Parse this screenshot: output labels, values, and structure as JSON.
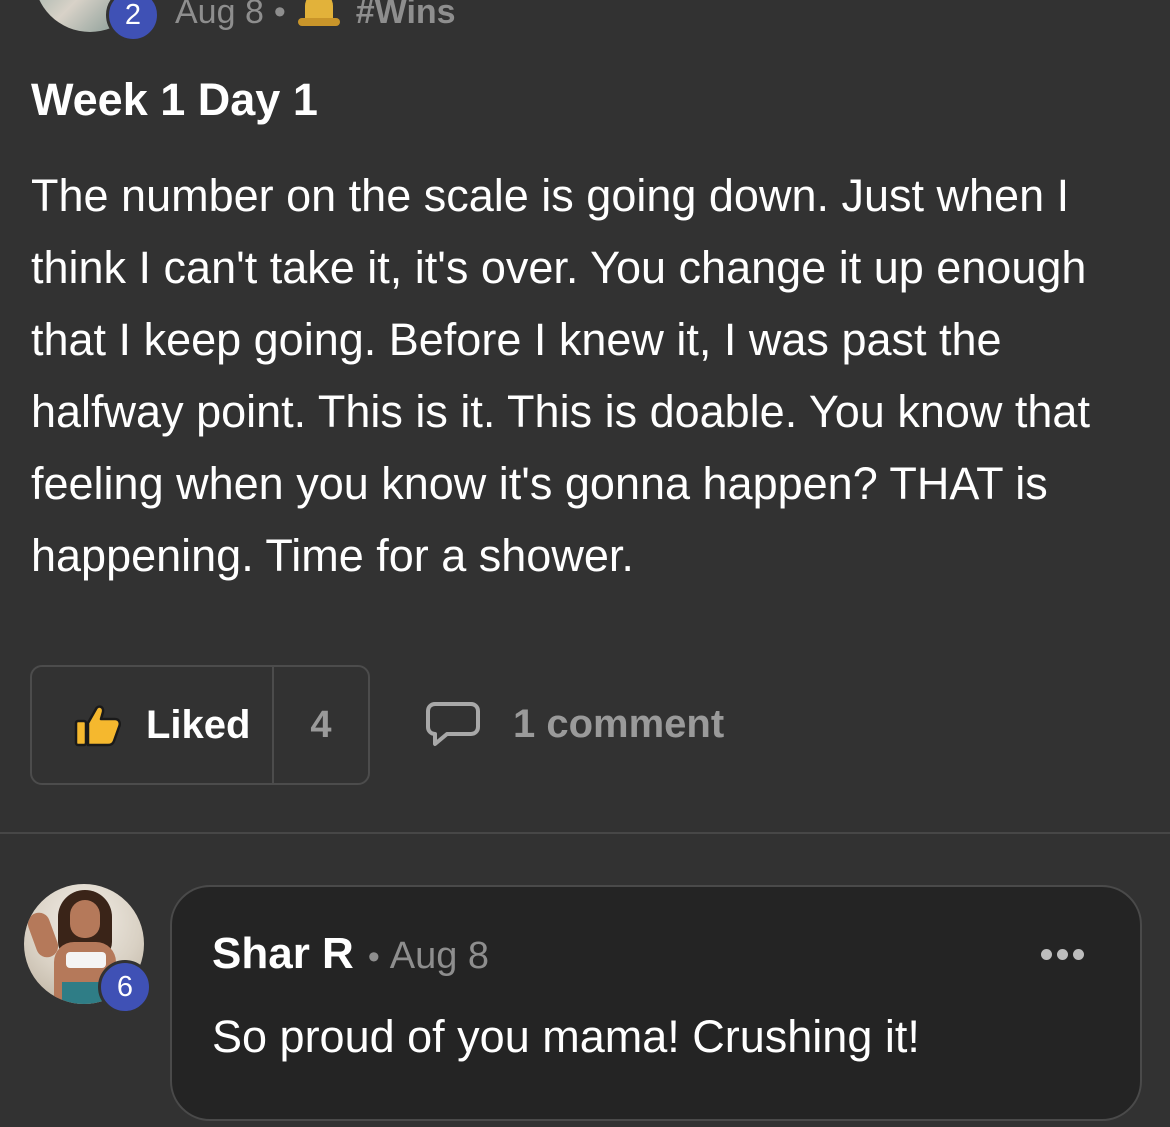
{
  "post": {
    "author_level": "2",
    "date": "Aug 8",
    "separator": "•",
    "category": "#Wins",
    "title": "Week 1 Day 1",
    "body": "The number on the scale is going down. Just when I think I can't take it, it's over. You change it up enough that I keep going. Before I knew it, I was past the halfway point. This is it. This is doable. You know that feeling when you know it's gonna happen? THAT is happening. Time for a shower.",
    "category_icon": "bell-icon"
  },
  "actions": {
    "like_label": "Liked",
    "like_count": "4",
    "like_icon": "thumbs-up-icon",
    "comment_label": "1 comment",
    "comment_icon": "speech-bubble-icon"
  },
  "comment": {
    "author": "Shar R",
    "author_level": "6",
    "separator": "•",
    "date": "Aug 8",
    "text": "So proud of you mama! Crushing it!",
    "menu_icon": "more-dots-icon"
  },
  "colors": {
    "background": "#323232",
    "card_background": "#242424",
    "level_badge": "#3f51b5",
    "muted_text": "#8e8e8e",
    "like_thumb": "#f5b82e"
  }
}
